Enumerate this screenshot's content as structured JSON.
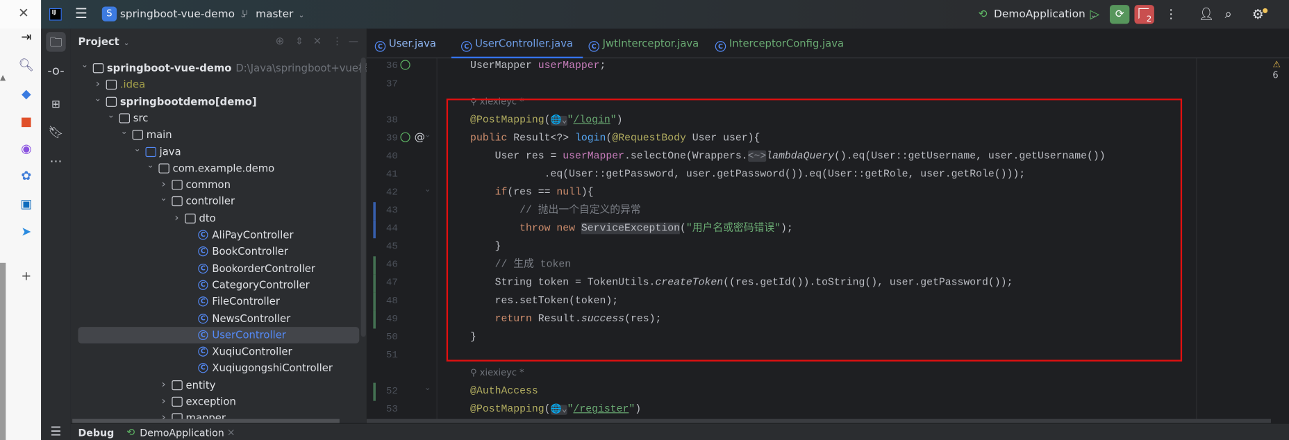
{
  "browser_sidebar": {
    "close": "✕",
    "icons": [
      "sign-in-icon",
      "search-icon",
      "tag-icon",
      "toolbox-icon",
      "game-controller-icon",
      "copilot-icon",
      "outlook-icon",
      "paper-plane-icon",
      "plus-icon"
    ]
  },
  "titlebar": {
    "project_badge": "S",
    "project_name": "springboot-vue-demo",
    "branch": "master",
    "run_config": "DemoApplication",
    "stop_count": "2"
  },
  "project_panel": {
    "title": "Project",
    "tree": [
      {
        "level": 0,
        "kind": "module",
        "expanded": true,
        "label": "springboot-vue-demo",
        "extra": "D:\\Java\\springboot+vue框架\\springboot",
        "bold": true
      },
      {
        "level": 1,
        "kind": "folder",
        "expanded": false,
        "label": ".idea",
        "color": "#a6a24b"
      },
      {
        "level": 1,
        "kind": "module",
        "expanded": true,
        "label": "springbootdemo",
        "extra2": "[demo]",
        "bold": true
      },
      {
        "level": 2,
        "kind": "folder",
        "expanded": true,
        "label": "src"
      },
      {
        "level": 3,
        "kind": "folder",
        "expanded": true,
        "label": "main"
      },
      {
        "level": 4,
        "kind": "srcfolder",
        "expanded": true,
        "label": "java"
      },
      {
        "level": 5,
        "kind": "package",
        "expanded": true,
        "label": "com.example.demo"
      },
      {
        "level": 6,
        "kind": "package",
        "expanded": false,
        "label": "common"
      },
      {
        "level": 6,
        "kind": "package",
        "expanded": true,
        "label": "controller"
      },
      {
        "level": 7,
        "kind": "package",
        "expanded": false,
        "label": "dto"
      },
      {
        "level": 8,
        "kind": "class",
        "label": "AliPayController"
      },
      {
        "level": 8,
        "kind": "class",
        "label": "BookController"
      },
      {
        "level": 8,
        "kind": "class",
        "label": "BookorderController"
      },
      {
        "level": 8,
        "kind": "class",
        "label": "CategoryController"
      },
      {
        "level": 8,
        "kind": "class",
        "label": "FileController"
      },
      {
        "level": 8,
        "kind": "class",
        "label": "NewsController"
      },
      {
        "level": 8,
        "kind": "class",
        "label": "UserController",
        "selected": true,
        "color": "#548af7"
      },
      {
        "level": 8,
        "kind": "class",
        "label": "XuqiuController"
      },
      {
        "level": 8,
        "kind": "class",
        "label": "XuqiugongshiController"
      },
      {
        "level": 6,
        "kind": "package",
        "expanded": false,
        "label": "entity"
      },
      {
        "level": 6,
        "kind": "package",
        "expanded": false,
        "label": "exception"
      },
      {
        "level": 6,
        "kind": "package",
        "expanded": false,
        "label": "mapper"
      }
    ]
  },
  "tabs": [
    {
      "label": "User.java",
      "color": "#8fb6f2",
      "active": false
    },
    {
      "label": "UserController.java",
      "color": "#6f9fe8",
      "active": true
    },
    {
      "label": "JwtInterceptor.java",
      "color": "#6aab73",
      "active": false
    },
    {
      "label": "InterceptorConfig.java",
      "color": "#6aab73",
      "active": false
    }
  ],
  "editor": {
    "warning_count": "6",
    "accent": "#3574f0",
    "lines": [
      {
        "num": "36",
        "gutter": "bean",
        "tokens": [
          [
            "UserMapper ",
            ""
          ],
          [
            "userMapper",
            "fld"
          ],
          [
            ";",
            ""
          ]
        ]
      },
      {
        "num": "37",
        "tokens": []
      },
      {
        "num": "",
        "author": "xiexieyc *"
      },
      {
        "num": "38",
        "tokens": [
          [
            "@PostMapping",
            "ann"
          ],
          [
            "(",
            ""
          ],
          [
            "🌐⌄",
            "hint globe"
          ],
          [
            "\"",
            "str"
          ],
          [
            "/login",
            "strl"
          ],
          [
            "\"",
            "str"
          ],
          [
            ")",
            ""
          ]
        ]
      },
      {
        "num": "39",
        "gutter": "bean-at",
        "fold": true,
        "tokens": [
          [
            "public ",
            "kw"
          ],
          [
            "Result<?> ",
            ""
          ],
          [
            "login",
            "fn"
          ],
          [
            "(",
            ""
          ],
          [
            "@RequestBody ",
            "ann"
          ],
          [
            "User user){",
            ""
          ]
        ]
      },
      {
        "num": "40",
        "tokens": [
          [
            "    User res = ",
            ""
          ],
          [
            "userMapper",
            "fld"
          ],
          [
            ".selectOne(Wrappers.",
            ""
          ],
          [
            "<~>",
            "hint"
          ],
          [
            "lambdaQuery",
            "it"
          ],
          [
            "().eq(User::getUsername, user.getUsername())",
            ""
          ]
        ]
      },
      {
        "num": "41",
        "tokens": [
          [
            "            .eq(User::getPassword, user.getPassword()).eq(User::getRole, user.getRole()));",
            ""
          ]
        ]
      },
      {
        "num": "42",
        "fold": true,
        "tokens": [
          [
            "    ",
            ""
          ],
          [
            "if",
            "kw"
          ],
          [
            "(res == ",
            ""
          ],
          [
            "null",
            "kw"
          ],
          [
            "){",
            ""
          ]
        ]
      },
      {
        "num": "43",
        "bar": "blue",
        "tokens": [
          [
            "        ",
            ""
          ],
          [
            "// 抛出一个自定义的异常",
            "cmt"
          ]
        ]
      },
      {
        "num": "44",
        "bar": "blue",
        "tokens": [
          [
            "        ",
            ""
          ],
          [
            "throw new ",
            "kw"
          ],
          [
            "ServiceException",
            "hl"
          ],
          [
            "(",
            ""
          ],
          [
            "\"用户名或密码错误\"",
            "str"
          ],
          [
            ");",
            ""
          ]
        ]
      },
      {
        "num": "45",
        "tokens": [
          [
            "    }",
            ""
          ]
        ]
      },
      {
        "num": "46",
        "bar": "green",
        "tokens": [
          [
            "    ",
            ""
          ],
          [
            "// 生成 token",
            "cmt"
          ]
        ]
      },
      {
        "num": "47",
        "bar": "green",
        "tokens": [
          [
            "    String token = TokenUtils.",
            ""
          ],
          [
            "createToken",
            "it"
          ],
          [
            "((res.getId()).toString(), user.getPassword());",
            ""
          ]
        ]
      },
      {
        "num": "48",
        "bar": "green",
        "tokens": [
          [
            "    res.setToken(token);",
            ""
          ]
        ]
      },
      {
        "num": "49",
        "bar": "green",
        "tokens": [
          [
            "    ",
            ""
          ],
          [
            "return ",
            "kw"
          ],
          [
            "Result.",
            ""
          ],
          [
            "success",
            "it"
          ],
          [
            "(res);",
            ""
          ]
        ]
      },
      {
        "num": "50",
        "tokens": [
          [
            "}",
            ""
          ]
        ]
      },
      {
        "num": "51",
        "tokens": []
      },
      {
        "num": "",
        "author": "xiexieyc *"
      },
      {
        "num": "52",
        "bar": "green",
        "fold": true,
        "tokens": [
          [
            "@AuthAccess",
            "ann"
          ]
        ]
      },
      {
        "num": "53",
        "tokens": [
          [
            "@PostMapping",
            "ann"
          ],
          [
            "(",
            ""
          ],
          [
            "🌐⌄",
            "hint globe"
          ],
          [
            "\"",
            "str"
          ],
          [
            "/register",
            "strl"
          ],
          [
            "\"",
            "str"
          ],
          [
            ")",
            ""
          ]
        ]
      }
    ]
  },
  "bottom": {
    "debug_label": "Debug",
    "run_tab": "DemoApplication",
    "close": "×"
  }
}
